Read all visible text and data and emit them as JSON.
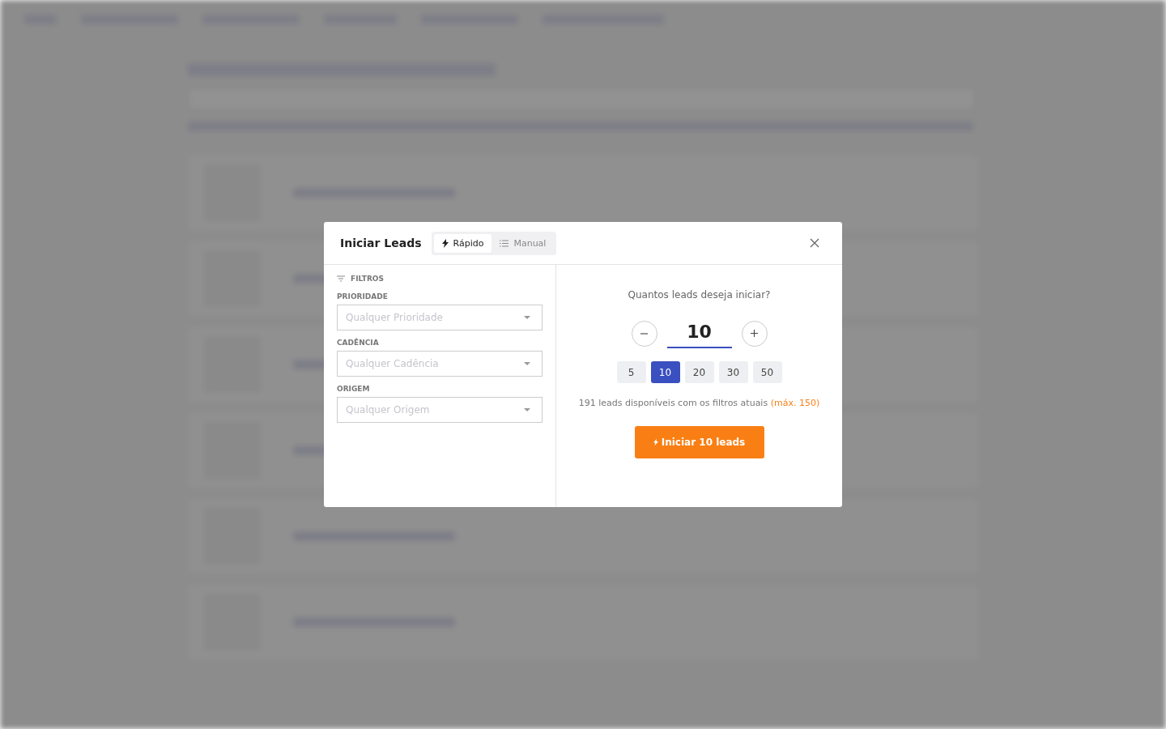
{
  "dialog": {
    "title": "Iniciar Leads",
    "modes": [
      {
        "label": "Rápido",
        "selected": true
      },
      {
        "label": "Manual",
        "selected": false
      }
    ],
    "filters": {
      "heading": "FILTROS",
      "fields": [
        {
          "label": "PRIORIDADE",
          "placeholder": "Qualquer Prioridade"
        },
        {
          "label": "CADÊNCIA",
          "placeholder": "Qualquer Cadência"
        },
        {
          "label": "ORIGEM",
          "placeholder": "Qualquer Origem"
        }
      ]
    },
    "question": "Quantos leads deseja iniciar?",
    "count": "10",
    "presets": [
      {
        "label": "5",
        "selected": false
      },
      {
        "label": "10",
        "selected": true
      },
      {
        "label": "20",
        "selected": false
      },
      {
        "label": "30",
        "selected": false
      },
      {
        "label": "50",
        "selected": false
      }
    ],
    "availability": "191 leads disponíveis com os filtros atuais",
    "max_note": "(máx. 150)",
    "start_button": "Iniciar 10 leads"
  }
}
